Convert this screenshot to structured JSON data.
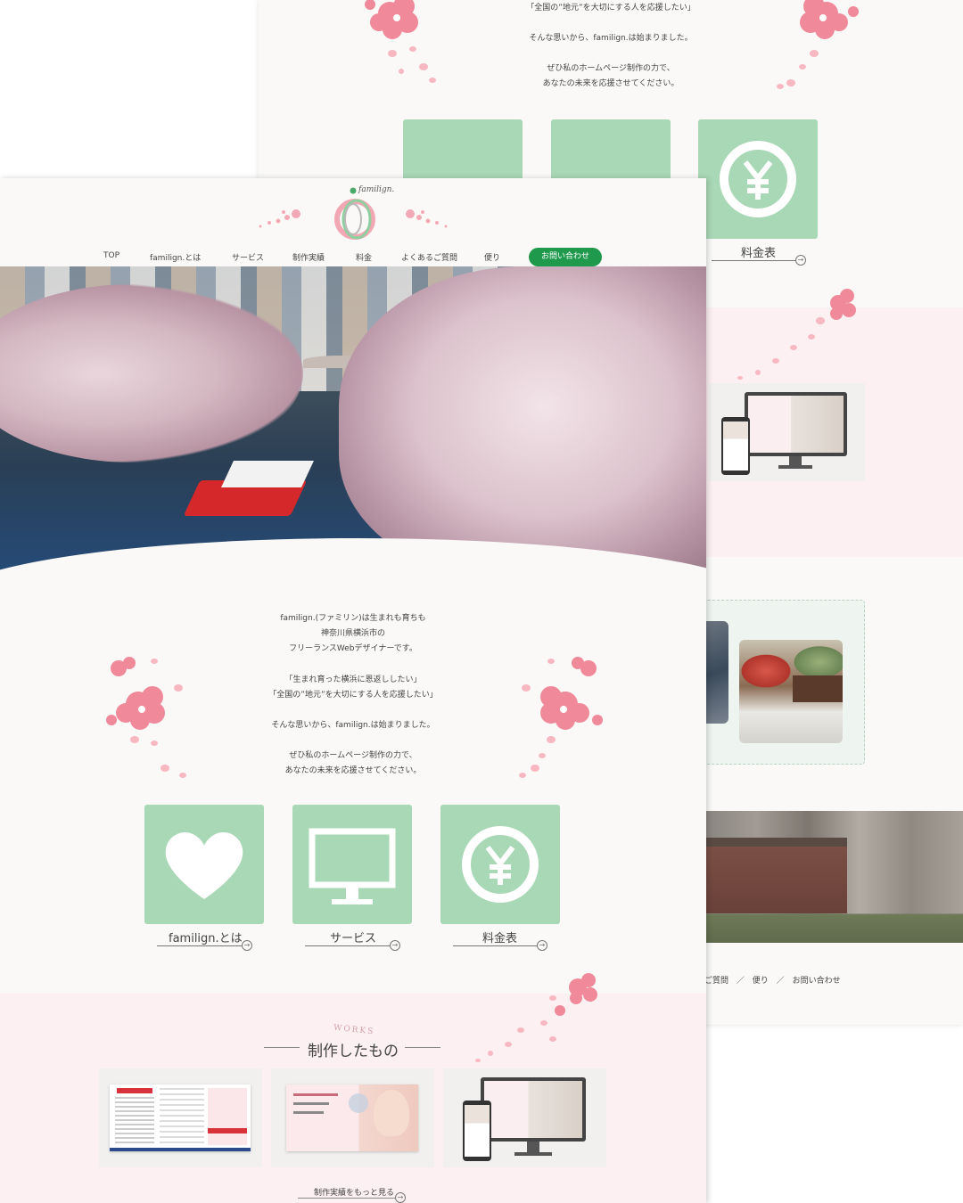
{
  "back_page": {
    "intro_lines": [
      "「全国の”地元”を大切にする人を応援したい」",
      "そんな思いから、familign.は始まりました。",
      "ぜひ私のホームページ制作の力で、",
      "あなたの未来を応援させてください。"
    ],
    "card_label": "料金表",
    "footer_nav": [
      "ご質問",
      "／",
      "便り",
      "／",
      "お問い合わせ"
    ]
  },
  "logo": {
    "text": "familign."
  },
  "nav": {
    "items": [
      "TOP",
      "familign.とは",
      "サービス",
      "制作実績",
      "料金",
      "よくあるご質問",
      "便り"
    ],
    "contact": "お問い合わせ"
  },
  "intro": {
    "lines": [
      "familign.(ファミリン)は生まれも育ちも",
      "神奈川県横浜市の",
      "フリーランスWebデザイナーです。",
      "「生まれ育った横浜に恩返ししたい」",
      "「全国の”地元”を大切にする人を応援したい」",
      "そんな思いから、familign.は始まりました。",
      "ぜひ私のホームページ制作の力で、",
      "あなたの未来を応援させてください。"
    ]
  },
  "cards": [
    {
      "label": "familign.とは",
      "icon": "heart-icon"
    },
    {
      "label": "サービス",
      "icon": "monitor-icon"
    },
    {
      "label": "料金表",
      "icon": "yen-icon"
    }
  ],
  "works": {
    "subtitle": "WORKS",
    "title": "制作したもの",
    "more": "制作実績をもっと見る"
  },
  "colors": {
    "card_green": "#a9d8b6",
    "contact_green": "#1f9a4c",
    "sakura_pink": "#f19aa8",
    "works_bg": "#fdf0f3"
  }
}
